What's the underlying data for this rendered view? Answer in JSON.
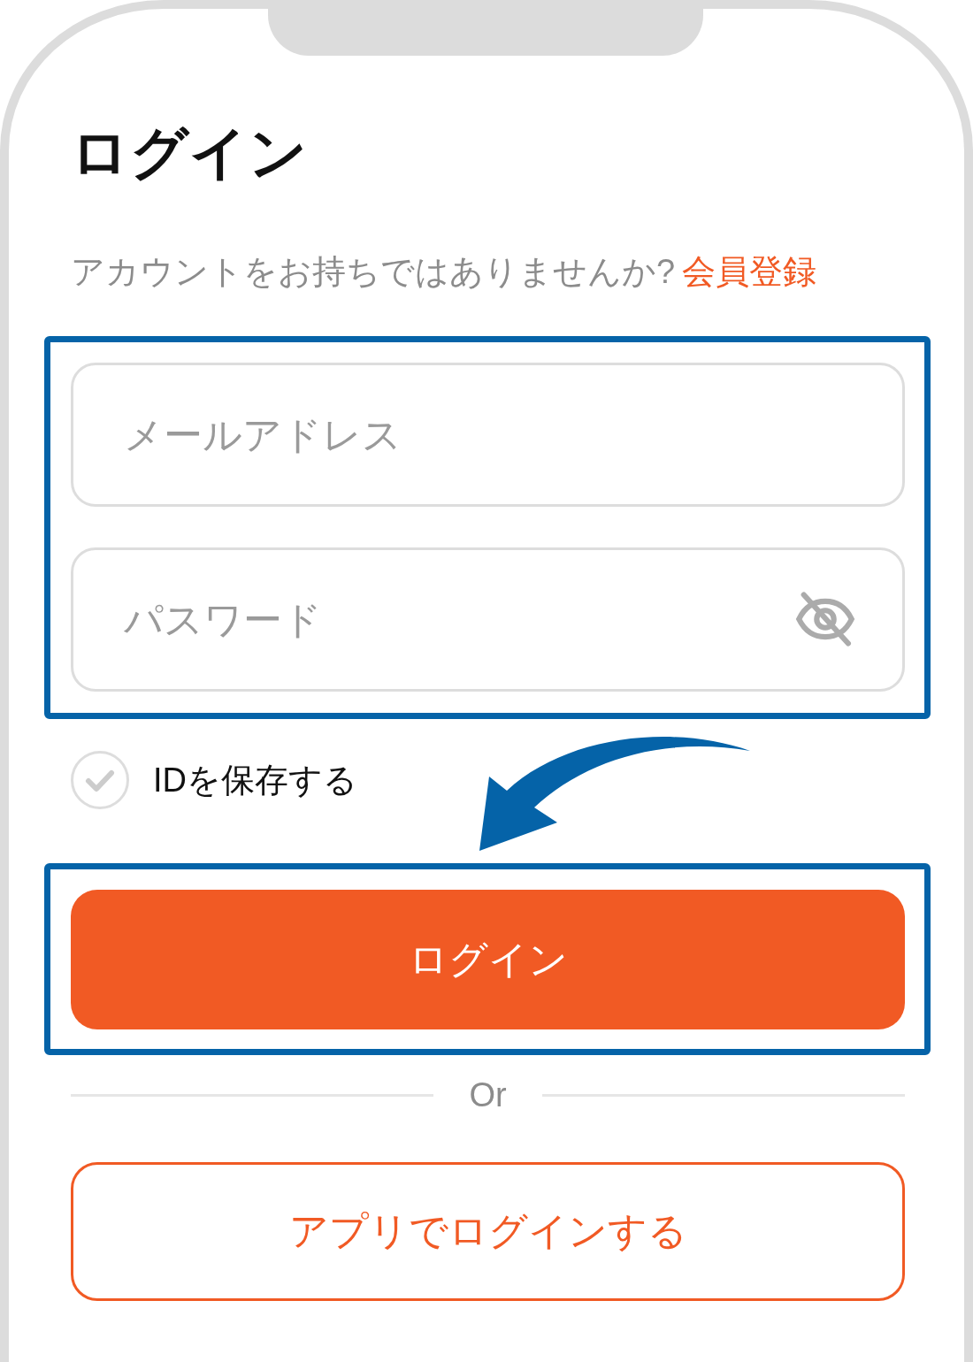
{
  "screen": {
    "title": "ログイン",
    "signup_prompt": {
      "text": "アカウントをお持ちではありませんか?",
      "link": "会員登録"
    }
  },
  "form": {
    "fields": [
      {
        "kind": "email",
        "placeholder": "メールアドレス"
      },
      {
        "kind": "password",
        "placeholder": "パスワード",
        "show_password": false
      }
    ],
    "remember_id": {
      "label": "IDを保存する",
      "checked": false
    },
    "login_button": "ログイン",
    "divider": "Or",
    "app_login_button": "アプリでログインする"
  }
}
